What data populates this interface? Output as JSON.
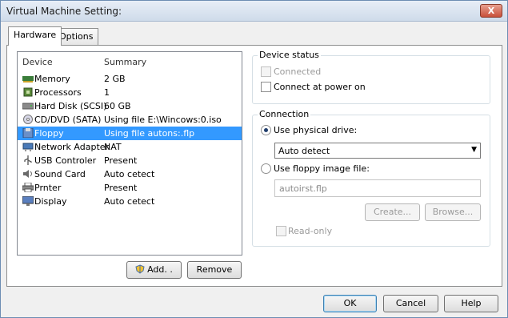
{
  "window": {
    "title": "Virtual Machine Setting:",
    "close_symbol": "X"
  },
  "tabs": [
    {
      "label": "Hardware"
    },
    {
      "label": "Options"
    }
  ],
  "device_list": {
    "headers": {
      "device": "Device",
      "summary": "Summary"
    },
    "rows": [
      {
        "device": "Memory",
        "summary": "2 GB",
        "icon": "memory-icon"
      },
      {
        "device": "Processors",
        "summary": "1",
        "icon": "processor-icon"
      },
      {
        "device": "Hard Disk (SCSI)",
        "summary": "60 GB",
        "icon": "hard-disk-icon"
      },
      {
        "device": "CD/DVD (SATA)",
        "summary": "Using file E:\\Wincows:0.iso",
        "icon": "cd-dvd-icon"
      },
      {
        "device": "Floppy",
        "summary": "Using file autons:.flp",
        "icon": "floppy-icon",
        "selected": true
      },
      {
        "device": "Network Adapter",
        "summary": "NAT",
        "icon": "network-adapter-icon"
      },
      {
        "device": "USB Controler",
        "summary": "Present",
        "icon": "usb-icon"
      },
      {
        "device": "Sound Card",
        "summary": "Auto cetect",
        "icon": "sound-card-icon"
      },
      {
        "device": "Prnter",
        "summary": "Present",
        "icon": "printer-icon"
      },
      {
        "device": "Display",
        "summary": "Auto cetect",
        "icon": "display-icon"
      }
    ],
    "add_label": "Add. .",
    "remove_label": "Remove"
  },
  "device_status": {
    "title": "Device status",
    "connected": {
      "label": "Connected",
      "checked": false,
      "disabled": true
    },
    "connect_at_power_on": {
      "label": "Connect at power on",
      "checked": false
    }
  },
  "connection": {
    "title": "Connection",
    "use_physical": {
      "label": "Use physical drive:",
      "selected": true
    },
    "physical_select": {
      "value": "Auto detect"
    },
    "use_image": {
      "label": "Use floppy image file:",
      "selected": false
    },
    "image_file": {
      "value": "autoirst.flp"
    },
    "create_label": "Create...",
    "browse_label": "Browse...",
    "read_only": {
      "label": "Read-only",
      "checked": false,
      "disabled": true
    }
  },
  "footer": {
    "ok_label": "OK",
    "cancel_label": "Cancel",
    "help_label": "Help"
  },
  "colors": {
    "selection": "#3399ff",
    "title_bar": "#cfdbea",
    "border": "#828790"
  }
}
